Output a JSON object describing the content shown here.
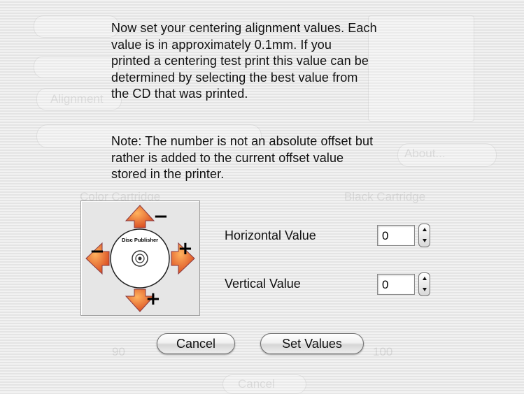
{
  "dialog": {
    "instructions": "Now set your centering alignment values.  Each\nvalue is in approximately 0.1mm.  If you\nprinted a centering test print this value can be\ndetermined by selecting the best value from\nthe CD that was printed.",
    "note": "Note:  The number is not an absolute offset but\nrather is added to the current offset value\nstored in the printer.",
    "disc_logo_text": "Disc Publisher",
    "arrow_signs": {
      "top": "−",
      "left": "−",
      "right": "+",
      "bottom": "+"
    },
    "horizontal": {
      "label": "Horizontal Value",
      "value": "0"
    },
    "vertical": {
      "label": "Vertical Value",
      "value": "0"
    },
    "cancel_label": "Cancel",
    "set_values_label": "Set Values"
  },
  "background_window": {
    "color_cartridge_label": "Color Cartridge",
    "black_cartridge_label": "Black Cartridge",
    "about_label": "About...",
    "left_value": "90",
    "right_value": "100",
    "cancel_label": "Cancel",
    "alignment_label": "Alignment"
  },
  "colors": {
    "arrow_light": "#ffb25e",
    "arrow_dark": "#d23a16",
    "arrow_shadow": "#7a3a6e"
  }
}
